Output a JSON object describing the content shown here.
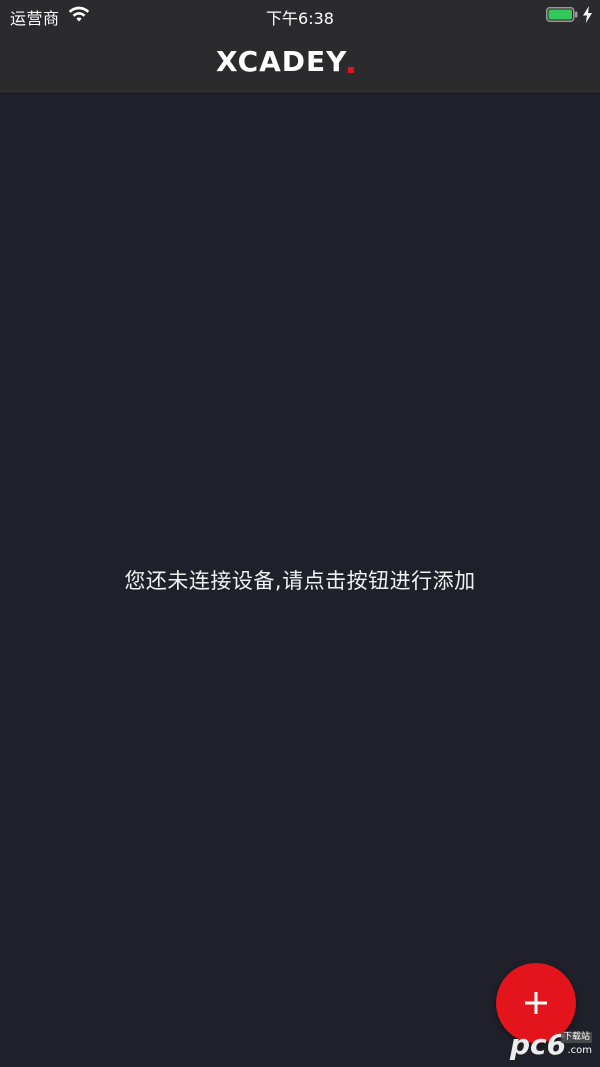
{
  "status_bar": {
    "carrier": "运营商",
    "time": "下午6:38",
    "wifi_icon": "wifi-icon",
    "battery_icon": "battery-full-icon",
    "charging_icon": "charging-bolt-icon",
    "battery_color": "#34c759"
  },
  "header": {
    "logo_text": "XCADEY",
    "logo_accent_color": "#e0141e"
  },
  "main": {
    "empty_message": "您还未连接设备,请点击按钮进行添加"
  },
  "fab": {
    "icon": "plus-icon",
    "color": "#e3141c"
  },
  "watermark": {
    "brand": "pc6",
    "tag": "下载站",
    "domain": ".com"
  }
}
